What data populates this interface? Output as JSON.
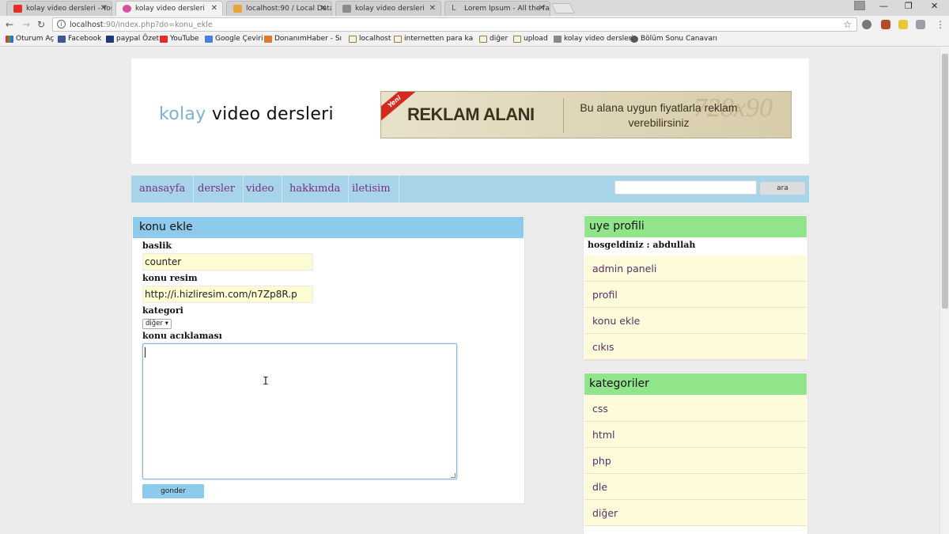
{
  "browser": {
    "tabs": [
      {
        "label": "kolay video dersleri - You",
        "favicon_color": "#e52d27"
      },
      {
        "label": "kolay video dersleri",
        "favicon_color": "#d84fa0"
      },
      {
        "label": "localhost:90 / Local Data",
        "favicon_color": "#e8a43a"
      },
      {
        "label": "kolay video dersleri",
        "favicon_color": "#8a8a8a"
      },
      {
        "label": "Lorem Ipsum - All the fac",
        "favicon_color": "#555555"
      }
    ],
    "url_host": "localhost",
    "url_path": ":90/index.php?do=konu_ekle",
    "bookmarks": [
      {
        "label": "Oturum Aç",
        "icon": "apps-icon"
      },
      {
        "label": "Facebook",
        "icon": "facebook-icon"
      },
      {
        "label": "paypal Özet",
        "icon": "paypal-icon"
      },
      {
        "label": "YouTube",
        "icon": "youtube-icon"
      },
      {
        "label": "Google Çeviri",
        "icon": "translate-icon"
      },
      {
        "label": "DonanımHaber - Sık S",
        "icon": "dh-icon"
      },
      {
        "label": "localhost",
        "icon": "folder-icon"
      },
      {
        "label": "internetten para kaza",
        "icon": "folder-icon"
      },
      {
        "label": "diğer",
        "icon": "folder-icon"
      },
      {
        "label": "upload",
        "icon": "folder-icon"
      },
      {
        "label": "kolay video dersleri",
        "icon": "page-icon"
      },
      {
        "label": "Bölüm Sonu Canavarı",
        "icon": "bsc-icon"
      }
    ]
  },
  "site": {
    "logo_first": "kolay",
    "logo_rest": " video dersleri",
    "ad": {
      "badge": "Yeni",
      "title": "REKLAM ALANI",
      "text": "Bu alana uygun fiyatlarla reklam verebilirsiniz",
      "size": "728x90"
    },
    "nav": [
      "anasayfa",
      "dersler",
      "video",
      "hakkımda",
      "iletisim"
    ],
    "search_button": "ara",
    "search_value": ""
  },
  "form": {
    "title": "konu ekle",
    "baslik_label": "baslik",
    "baslik_value": "counter",
    "resim_label": "konu resim",
    "resim_value": "http://i.hizliresim.com/n7Zp8R.p",
    "kategori_label": "kategori",
    "kategori_value": "diğer ▾",
    "aciklama_label": "konu acıklaması",
    "aciklama_value": "",
    "submit_label": "gonder"
  },
  "profile": {
    "title": "uye profili",
    "welcome": "hosgeldiniz : abdullah",
    "links": [
      "admin paneli",
      "profil",
      "konu ekle",
      "cıkıs"
    ]
  },
  "categories": {
    "title": "kategoriler",
    "items": [
      "css",
      "html",
      "php",
      "dle",
      "diğer"
    ]
  }
}
